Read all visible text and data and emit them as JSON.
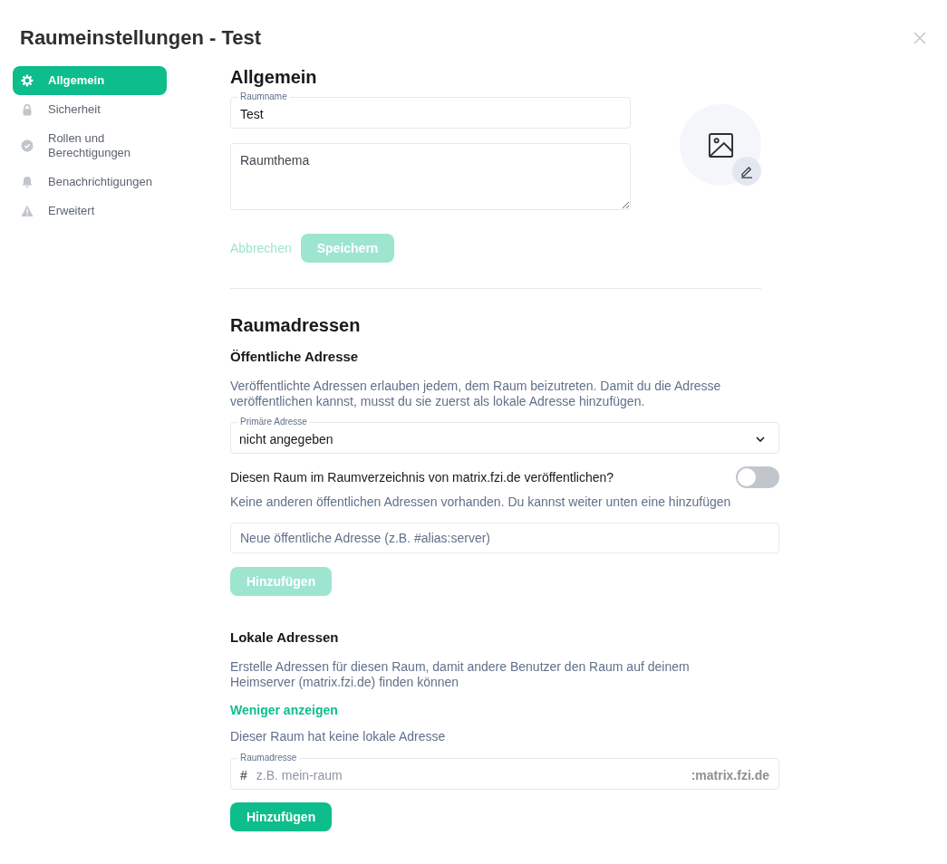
{
  "dialog": {
    "title": "Raumeinstellungen - Test"
  },
  "sidebar": {
    "items": [
      {
        "label": "Allgemein",
        "selected": true
      },
      {
        "label": "Sicherheit",
        "selected": false
      },
      {
        "label": "Rollen und Berechtigungen",
        "selected": false
      },
      {
        "label": "Benachrichtigungen",
        "selected": false
      },
      {
        "label": "Erweitert",
        "selected": false
      }
    ]
  },
  "general": {
    "heading": "Allgemein",
    "name_field": {
      "label": "Raumname",
      "value": "Test"
    },
    "topic_field": {
      "placeholder": "Raumthema"
    },
    "cancel_button": {
      "label": "Abbrechen",
      "disabled": true
    },
    "save_button": {
      "label": "Speichern",
      "disabled": true
    }
  },
  "addresses": {
    "heading": "Raumadressen",
    "public": {
      "heading": "Öffentliche Adresse",
      "description": "Veröffentlichte Adressen erlauben jedem, dem Raum beizutreten. Damit du die Adresse veröffentlichen kannst, musst du sie zuerst als lokale Adresse hinzufügen.",
      "primary_select": {
        "label": "Primäre Adresse",
        "value": "nicht angegeben"
      },
      "publish_toggle": {
        "label": "Diesen Raum im Raumverzeichnis von matrix.fzi.de veröffentlichen?",
        "on": false
      },
      "note": "Keine anderen öffentlichen Adressen vorhanden. Du kannst weiter unten eine hinzufügen",
      "new_address_field": {
        "placeholder": "Neue öffentliche Adresse (z.B. #alias:server)"
      },
      "add_button": {
        "label": "Hinzufügen",
        "disabled": true
      }
    },
    "local": {
      "heading": "Lokale Adressen",
      "description": "Erstelle Adressen für diesen Raum, damit andere Benutzer den Raum auf deinem Heimserver (matrix.fzi.de) finden können",
      "toggle_link": "Weniger anzeigen",
      "empty_note": "Dieser Raum hat keine lokale Adresse",
      "address_field": {
        "label": "Raumadresse",
        "prefix": "#",
        "placeholder": "z.B. mein-raum",
        "suffix": ":matrix.fzi.de"
      },
      "add_button": {
        "label": "Hinzufügen",
        "disabled": false
      }
    }
  }
}
